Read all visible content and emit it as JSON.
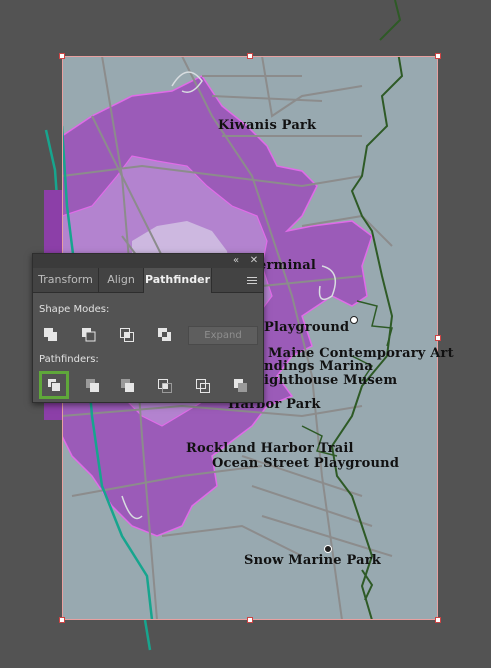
{
  "map": {
    "labels": {
      "kiwanis": "Kiwanis Park",
      "terminal": "erminal",
      "playground": "Playground",
      "maine_art": "Maine Contemporary Art",
      "marina": "ndings Marina",
      "lighthouse": "ighthouse Musem",
      "harbor_park": "Harbor Park",
      "harbor_trail": "Rockland Harbor Trail",
      "ocean_street": "Ocean Street Playground",
      "snow_marine": "Snow Marine Park"
    },
    "colors": {
      "background": "#98a9b0",
      "buffer_outer": "#9b5bb8",
      "buffer_mid": "#b383cf",
      "buffer_inner": "#cdb8e0",
      "buffer_edge": "#e06be8",
      "roads": "#8c8c8c",
      "trail": "#2e5a26",
      "stream": "#17a58e"
    }
  },
  "panel": {
    "collapse_icon": "double-chevron-icon",
    "close_icon": "close-icon",
    "tabs": [
      "Transform",
      "Align",
      "Pathfinder"
    ],
    "active_tab": "Pathfinder",
    "shape_modes_label": "Shape Modes:",
    "shape_modes": [
      "unite-icon",
      "minus-front-icon",
      "intersect-icon",
      "exclude-icon"
    ],
    "expand_label": "Expand",
    "pathfinders_label": "Pathfinders:",
    "pathfinders": [
      "divide-icon",
      "trim-icon",
      "merge-icon",
      "crop-icon",
      "outline-icon",
      "minus-back-icon"
    ],
    "selected_pathfinder": "divide-icon"
  }
}
